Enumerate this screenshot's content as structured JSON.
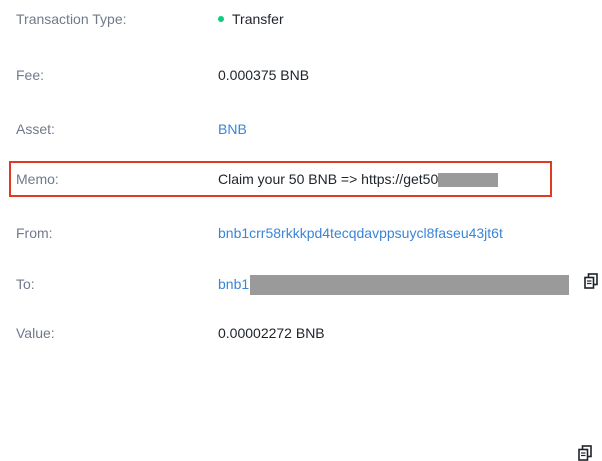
{
  "rows": {
    "type": {
      "label": "Transaction Type:",
      "value": "Transfer",
      "status_color": "#0ecb81"
    },
    "fee": {
      "label": "Fee:",
      "value": "0.000375 BNB"
    },
    "asset": {
      "label": "Asset:",
      "value": "BNB"
    },
    "memo": {
      "label": "Memo:",
      "value": "Claim your 50 BNB => https://get50"
    },
    "from": {
      "label": "From:",
      "value": "bnb1crr58rkkkpd4tecqdavppsuycl8faseu43jt6t",
      "icon": "copy-icon"
    },
    "to": {
      "label": "To:",
      "value": "bnb1",
      "icon": "copy-icon"
    },
    "value": {
      "label": "Value:",
      "value": "0.00002272 BNB"
    }
  },
  "colors": {
    "label": "#707a8a",
    "text": "#1e2329",
    "link": "#3a85d8",
    "highlight_border": "#e03a23",
    "redaction": "#9a9a9a"
  }
}
